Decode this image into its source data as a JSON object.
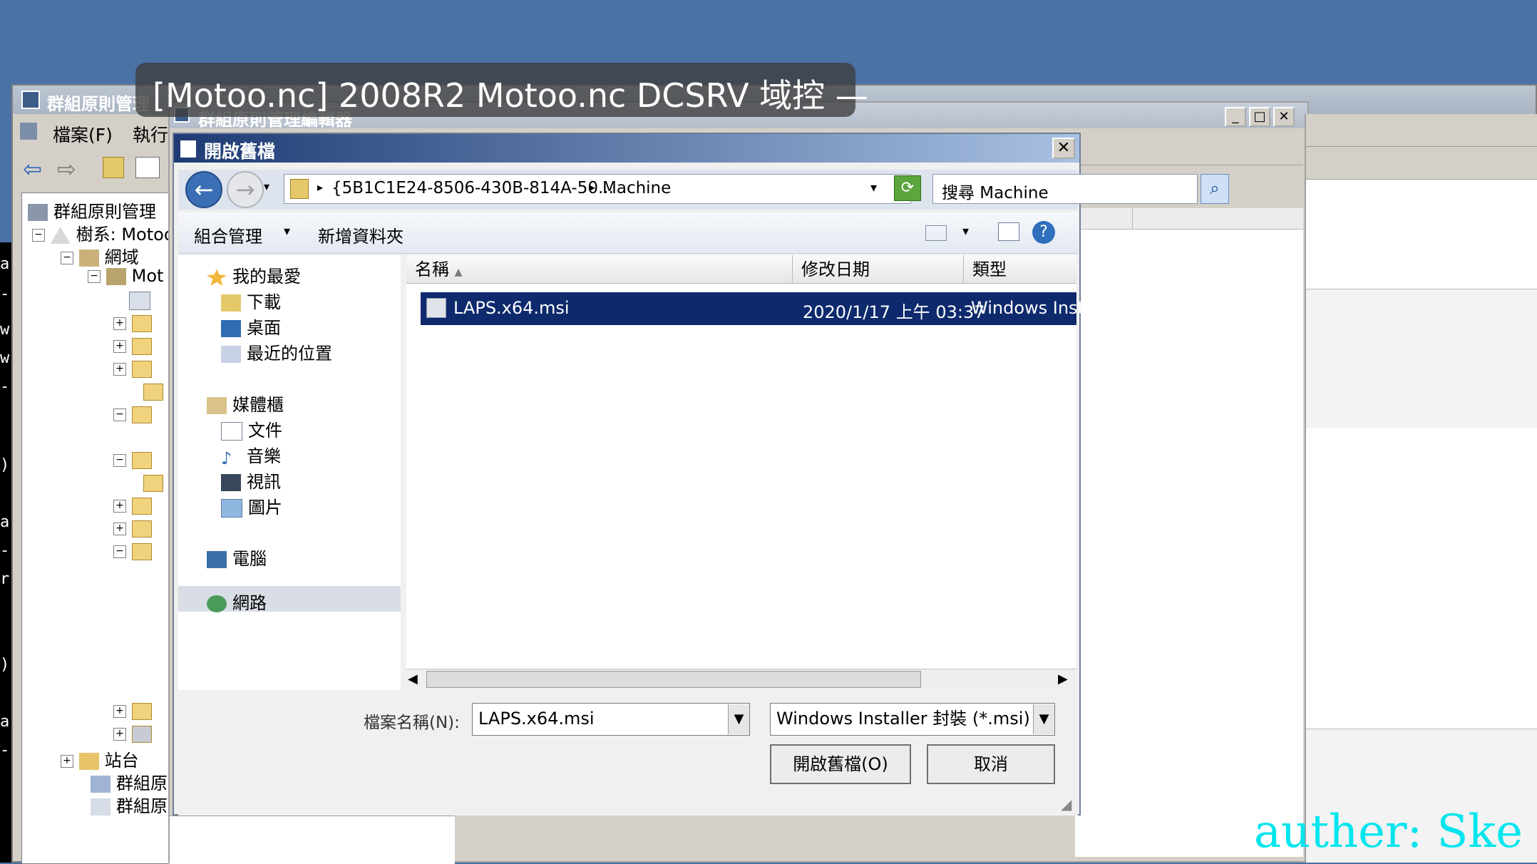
{
  "overlay": {
    "text": "[Motoo.nc] 2008R2 Motoo.nc DCSRV 域控 —"
  },
  "gpmc": {
    "title": "群組原則管理",
    "menu": [
      "檔案(F)",
      "執行"
    ],
    "tree": [
      "群組原則管理",
      "樹系: Motoo",
      "網域",
      "Mot",
      "站台",
      "群組原則",
      "群組原則"
    ]
  },
  "gpme": {
    "title": "群組原則管理編輯器",
    "buttons": [
      "_",
      "□",
      "✕"
    ]
  },
  "dialog": {
    "title": "開啟舊檔",
    "close": "✕",
    "address": {
      "path": "{5B1C1E24-8506-430B-814A-50...",
      "current": "Machine"
    },
    "search_placeholder": "搜尋 Machine",
    "toolbar": {
      "organize": "組合管理",
      "new_folder": "新增資料夾"
    },
    "nav": {
      "favorites": "我的最愛",
      "downloads": "下載",
      "desktop": "桌面",
      "recent": "最近的位置",
      "libraries": "媒體櫃",
      "documents": "文件",
      "music": "音樂",
      "videos": "視訊",
      "pictures": "圖片",
      "computer": "電腦",
      "network": "網路"
    },
    "columns": {
      "name": "名稱",
      "modified": "修改日期",
      "type": "類型"
    },
    "files": [
      {
        "name": "LAPS.x64.msi",
        "modified": "2020/1/17 上午 03:37",
        "type": "Windows Install"
      }
    ],
    "filename_label": "檔案名稱(N):",
    "filename_value": "LAPS.x64.msi",
    "filter_value": "Windows Installer 封裝 (*.msi)",
    "open_button": "開啟舊檔(O)",
    "cancel_button": "取消"
  },
  "watermark": "auther: Ske"
}
